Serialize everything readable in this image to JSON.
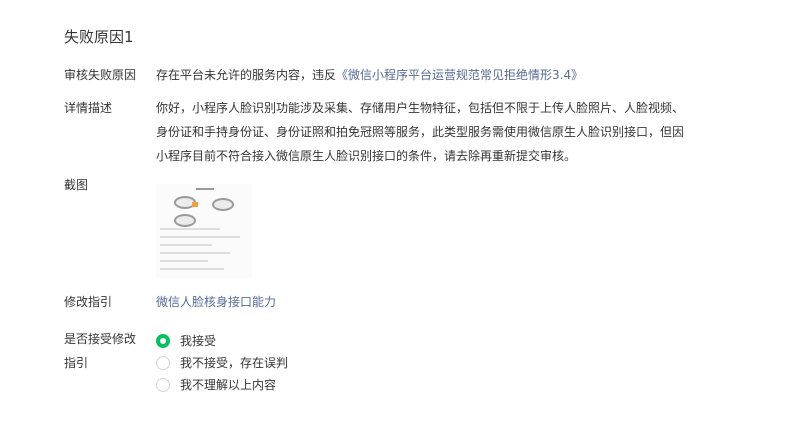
{
  "section_title": "失败原因1",
  "reason": {
    "label": "审核失败原因",
    "text": "存在平台未允许的服务内容，违反",
    "link": "《微信小程序平台运营规范常见拒绝情形3.4》"
  },
  "detail": {
    "label": "详情描述",
    "lines": [
      "你好，小程序人脸识别功能涉及采集、存储用户生物特征，包括但不限于上传人脸照片、人脸视频、",
      "身份证和手持身份证、身份证照和拍免冠照等服务，此类型服务需使用微信原生人脸识别接口，但因",
      "小程序目前不符合接入微信原生人脸识别接口的条件，请去除再重新提交审核。"
    ]
  },
  "screenshot": {
    "label": "截图"
  },
  "guide": {
    "label": "修改指引",
    "link": "微信人脸核身接口能力"
  },
  "accept": {
    "label_line1": "是否接受修改",
    "label_line2": "指引",
    "options": [
      {
        "label": "我接受",
        "checked": true
      },
      {
        "label": "我不接受，存在误判",
        "checked": false
      },
      {
        "label": "我不理解以上内容",
        "checked": false
      }
    ]
  },
  "colors": {
    "link": "#576b95",
    "accent": "#07c160"
  }
}
